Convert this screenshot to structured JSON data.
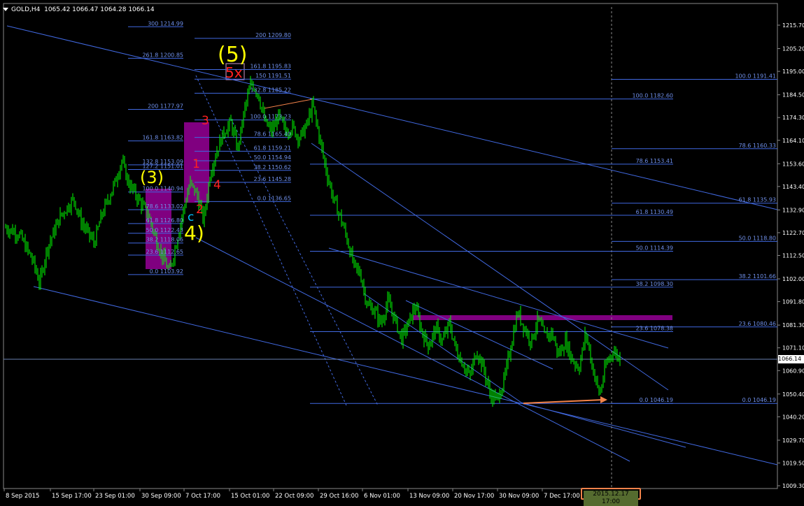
{
  "header": {
    "symbol": "GOLD,H4",
    "ohlc": "1065.42 1066.47 1064.28 1066.14"
  },
  "current_price_label": "1066.14",
  "cursor_time_label": "2015.12.17 17:00",
  "colors": {
    "background": "#000000",
    "candles": "#00ff00",
    "fib_lines": "#4169e1",
    "wave_major": "#ffff00",
    "wave_minor": "#ff0000",
    "wave_c": "#00bfff",
    "zone": "#800080",
    "arrow": "#f4834a"
  },
  "chart_data": {
    "type": "candlestick",
    "title": "GOLD,H4",
    "y_axis_ticks": [
      "1215.70",
      "1205.20",
      "1195.00",
      "1184.50",
      "1174.30",
      "1164.10",
      "1153.60",
      "1143.40",
      "1132.90",
      "1122.70",
      "1112.50",
      "1102.00",
      "1091.80",
      "1081.30",
      "1071.10",
      "1060.90",
      "1050.40",
      "1040.20",
      "1029.70",
      "1019.50",
      "1009.30"
    ],
    "x_axis_ticks": [
      "8 Sep 2015",
      "15 Sep 17:00",
      "23 Sep 01:00",
      "30 Sep 09:00",
      "7 Oct 17:00",
      "15 Oct 01:00",
      "22 Oct 09:00",
      "29 Oct 16:00",
      "6 Nov 01:00",
      "13 Nov 09:00",
      "20 Nov 17:00",
      "30 Nov 09:00",
      "7 Dec 17:00",
      "2015.12.17 17:00"
    ],
    "ylim": [
      1006,
      1224
    ],
    "close_path": [
      [
        0,
        1125
      ],
      [
        2,
        1122
      ],
      [
        4,
        1110
      ],
      [
        5,
        1100
      ],
      [
        6,
        1115
      ],
      [
        8,
        1130
      ],
      [
        10,
        1138
      ],
      [
        11,
        1128
      ],
      [
        13,
        1118
      ],
      [
        14,
        1130
      ],
      [
        16,
        1145
      ],
      [
        17,
        1155
      ],
      [
        18,
        1145
      ],
      [
        20,
        1135
      ],
      [
        21,
        1130
      ],
      [
        22,
        1120
      ],
      [
        23,
        1112
      ],
      [
        24,
        1105
      ],
      [
        25,
        1118
      ],
      [
        26,
        1132
      ],
      [
        27,
        1145
      ],
      [
        28,
        1140
      ],
      [
        29,
        1128
      ],
      [
        30,
        1150
      ],
      [
        31,
        1160
      ],
      [
        32,
        1168
      ],
      [
        33,
        1172
      ],
      [
        34,
        1160
      ],
      [
        35,
        1178
      ],
      [
        36,
        1190
      ],
      [
        37,
        1185
      ],
      [
        38,
        1172
      ],
      [
        39,
        1168
      ],
      [
        40,
        1175
      ],
      [
        41,
        1168
      ],
      [
        42,
        1170
      ],
      [
        43,
        1165
      ],
      [
        44,
        1170
      ],
      [
        45,
        1180
      ],
      [
        46,
        1165
      ],
      [
        47,
        1150
      ],
      [
        48,
        1138
      ],
      [
        49,
        1130
      ],
      [
        50,
        1120
      ],
      [
        51,
        1108
      ],
      [
        52,
        1104
      ],
      [
        53,
        1090
      ],
      [
        54,
        1088
      ],
      [
        55,
        1082
      ],
      [
        56,
        1092
      ],
      [
        57,
        1084
      ],
      [
        58,
        1075
      ],
      [
        59,
        1082
      ],
      [
        60,
        1090
      ],
      [
        61,
        1078
      ],
      [
        62,
        1072
      ],
      [
        63,
        1080
      ],
      [
        64,
        1074
      ],
      [
        65,
        1082
      ],
      [
        66,
        1070
      ],
      [
        67,
        1064
      ],
      [
        68,
        1058
      ],
      [
        69,
        1070
      ],
      [
        70,
        1062
      ],
      [
        71,
        1050
      ],
      [
        72,
        1048
      ],
      [
        73,
        1056
      ],
      [
        74,
        1072
      ],
      [
        75,
        1087
      ],
      [
        76,
        1080
      ],
      [
        77,
        1074
      ],
      [
        78,
        1084
      ],
      [
        79,
        1076
      ],
      [
        80,
        1078
      ],
      [
        81,
        1068
      ],
      [
        82,
        1074
      ],
      [
        83,
        1066
      ],
      [
        84,
        1062
      ],
      [
        85,
        1078
      ],
      [
        86,
        1062
      ],
      [
        87,
        1050
      ],
      [
        88,
        1064
      ],
      [
        89,
        1070
      ],
      [
        90,
        1066
      ]
    ],
    "fib_levels_left": [
      "300 1214.99",
      "261.8 1200.85",
      "200 1177.97",
      "161.8 1163.82",
      "132.8 1153.09",
      "127.2 1151.01",
      "100.0 1140.94",
      "78.6 1133.02",
      "61.8 1126.80",
      "50.0 1122.43",
      "38.2 1118.06",
      "23.6 1112.65",
      "0.0 1103.92"
    ],
    "fib_levels_mid": [
      "200 1209.80",
      "161.8 1195.83",
      "150 1191.51",
      "132.8 1185.22",
      "100.0 1173.23",
      "78.6 1165.40",
      "61.8 1159.21",
      "50.0 1154.94",
      "38.2 1150.62",
      "23.6 1145.28",
      "0.0 1136.65"
    ],
    "fib_levels_right_a": [
      "100.0 1182.60",
      "78.6 1153.41",
      "61.8 1130.49",
      "50.0 1114.39",
      "38.2 1098.30",
      "23.6 1078.38",
      "0.0 1046.19"
    ],
    "fib_levels_right_b": [
      "100.0 1191.41",
      "78.6 1160.33",
      "61.8 1135.93",
      "50.0 1118.80",
      "38.2 1101.66",
      "23.6 1080.46",
      "0.0 1046.19"
    ],
    "wave_labels": [
      "(5)",
      "(3)",
      "4)",
      "5x",
      "3",
      "4",
      "2",
      "1",
      "c"
    ]
  }
}
